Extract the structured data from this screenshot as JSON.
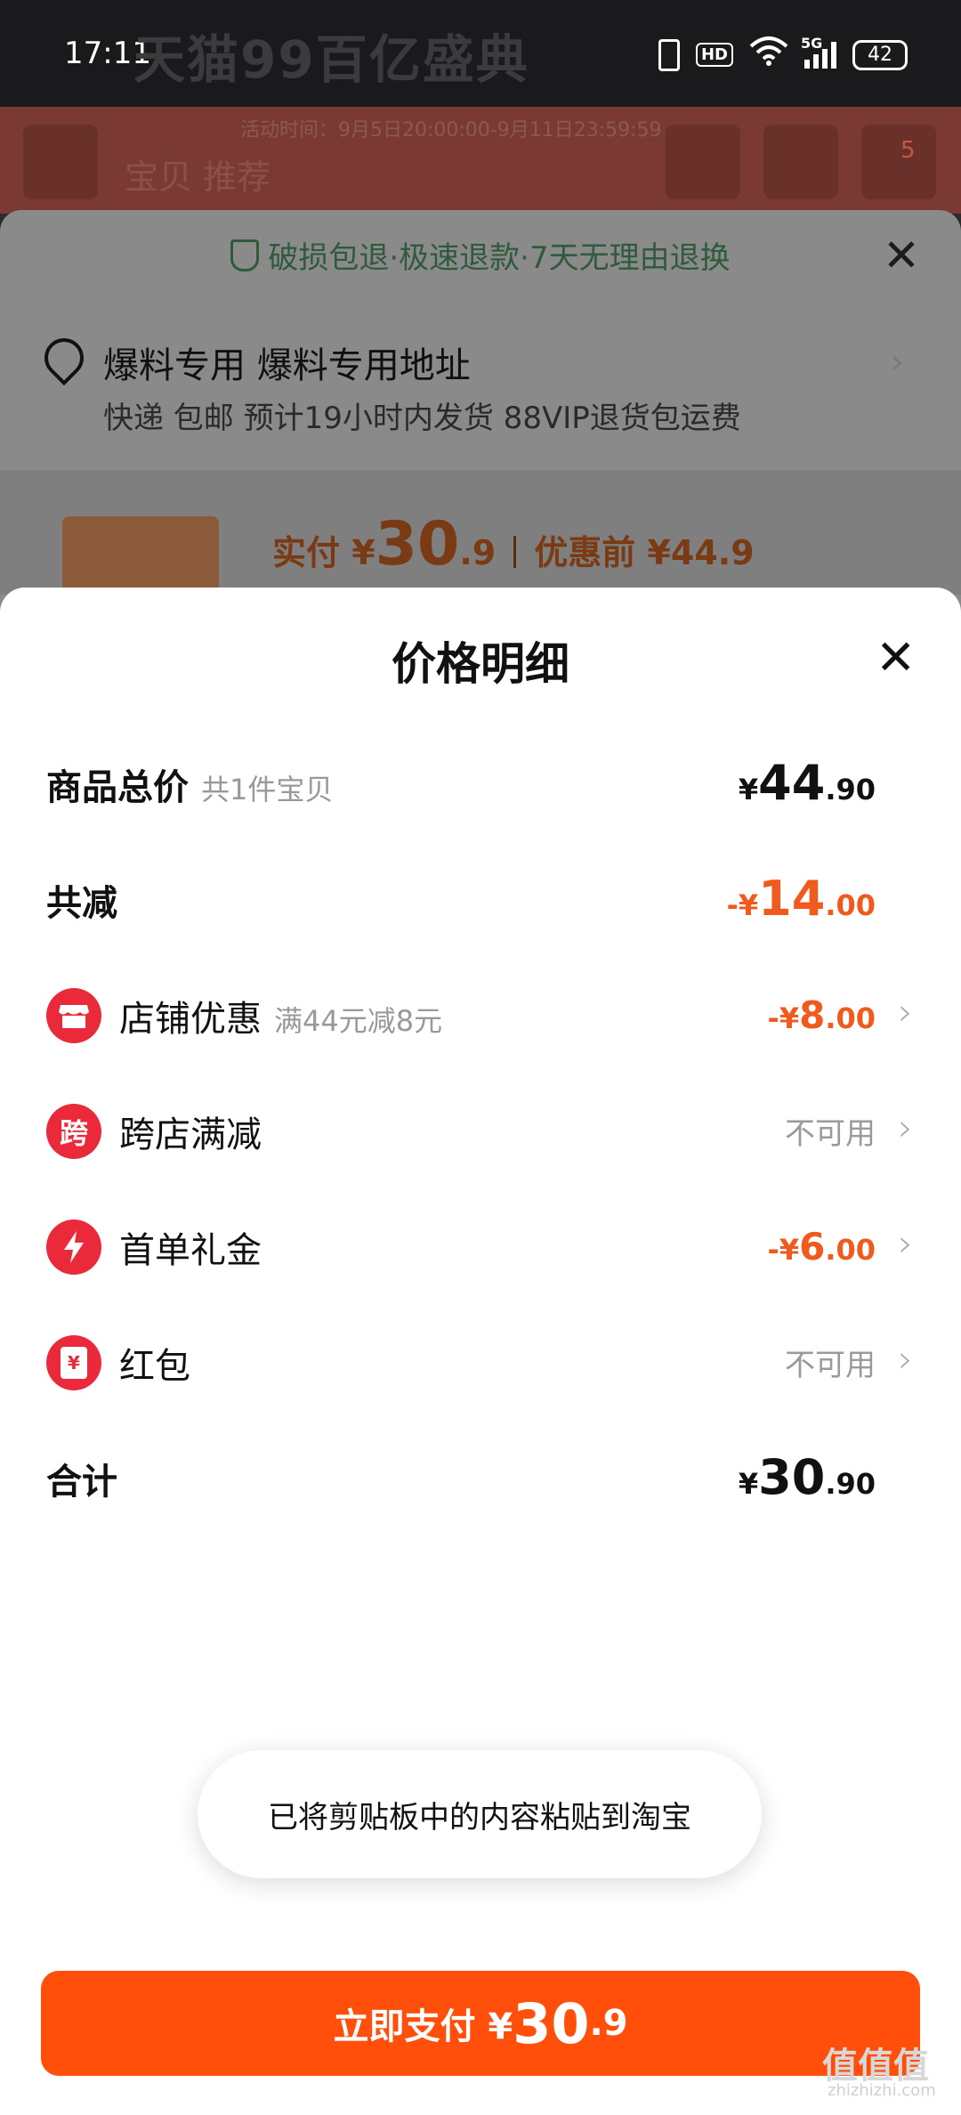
{
  "status_bar": {
    "time": "17:11",
    "hd": "HD",
    "network": "5G",
    "battery": "42"
  },
  "background": {
    "banner": "天猫99百亿盛典",
    "promo_dates": "活动时间：9月5日20:00:00-9月11日23:59:59",
    "nav_title": "宝贝 推荐",
    "cart_badge": "5",
    "guarantee": "破损包退·极速退款·7天无理由退换",
    "address_name": "爆料专用 爆料专用地址",
    "address_detail": "快递 包邮 预计19小时内发货 88VIP退货包运费",
    "paid_label": "实付 ¥",
    "paid_int": "30",
    "paid_dec": ".9",
    "before_label": "优惠前 ¥44.9"
  },
  "panel": {
    "title": "价格明细",
    "rows": {
      "total": {
        "label": "商品总价",
        "sub": "共1件宝贝",
        "cur": "¥",
        "int": "44",
        "dec": ".90"
      },
      "reduce": {
        "label": "共减",
        "prefix": "-¥",
        "int": "14",
        "dec": ".00"
      },
      "store": {
        "icon": "store-icon",
        "label": "店铺优惠",
        "sub": "满44元减8元",
        "prefix": "-¥",
        "int": "8",
        "dec": ".00"
      },
      "cross": {
        "icon": "cross-store-icon",
        "icon_text": "跨",
        "label": "跨店满减",
        "status": "不可用"
      },
      "first": {
        "icon": "lightning-icon",
        "label": "首单礼金",
        "prefix": "-¥",
        "int": "6",
        "dec": ".00"
      },
      "redpacket": {
        "icon": "red-packet-icon",
        "icon_text": "¥",
        "label": "红包",
        "status": "不可用"
      },
      "sum": {
        "label": "合计",
        "cur": "¥",
        "int": "30",
        "dec": ".90"
      }
    }
  },
  "toast": "已将剪贴板中的内容粘贴到淘宝",
  "pay_button": {
    "label": "立即支付 ¥",
    "int": "30",
    "dec": ".9"
  },
  "watermark": {
    "main": "值值值",
    "sub": "zhizhizhi.com"
  },
  "colors": {
    "accent": "#ff4f0a",
    "discount": "#f15a1d",
    "icon_red": "#ea2a3a"
  }
}
